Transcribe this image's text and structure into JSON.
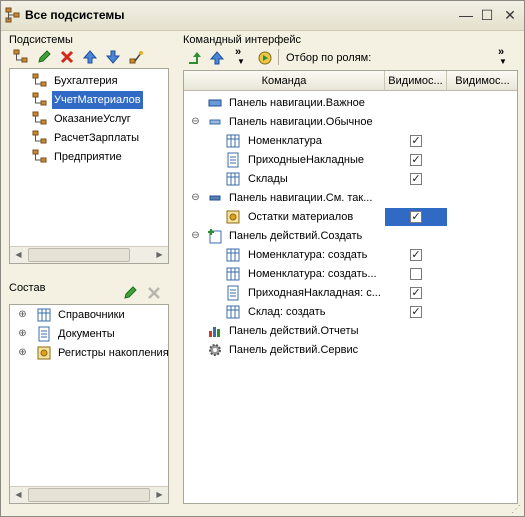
{
  "window": {
    "title": "Все подсистемы",
    "controls": {
      "minimize": "—",
      "maximize": "☐",
      "close": "✕"
    }
  },
  "subsystems": {
    "label": "Подсистемы",
    "items": [
      {
        "label": "Бухгалтерия"
      },
      {
        "label": "УчетМатериалов",
        "selected": true
      },
      {
        "label": "ОказаниеУслуг"
      },
      {
        "label": "РасчетЗарплаты"
      },
      {
        "label": "Предприятие"
      }
    ]
  },
  "composition": {
    "label": "Состав",
    "items": [
      {
        "label": "Справочники"
      },
      {
        "label": "Документы"
      },
      {
        "label": "Регистры накопления"
      }
    ]
  },
  "command_interface": {
    "label": "Командный интерфейс",
    "filter_label": "Отбор по ролям:",
    "columns": [
      "Команда",
      "Видимос...",
      "Видимос..."
    ],
    "rows": [
      {
        "label": "Панель навигации.Важное",
        "level": 0,
        "icon": "nav-panel-icon"
      },
      {
        "label": "Панель навигации.Обычное",
        "level": 0,
        "icon": "nav-panel-icon",
        "expander": "−"
      },
      {
        "label": "Номенклатура",
        "level": 1,
        "icon": "catalog-icon",
        "visible": true
      },
      {
        "label": "ПриходныеНакладные",
        "level": 1,
        "icon": "document-icon",
        "visible": true
      },
      {
        "label": "Склады",
        "level": 1,
        "icon": "catalog-icon",
        "visible": true
      },
      {
        "label": "Панель навигации.См. так...",
        "level": 0,
        "icon": "nav-panel-icon",
        "expander": "−"
      },
      {
        "label": "Остатки материалов",
        "level": 1,
        "icon": "register-icon",
        "visible": true,
        "selected": true
      },
      {
        "label": "Панель действий.Создать",
        "level": 0,
        "icon": "create-icon",
        "expander": "−"
      },
      {
        "label": "Номенклатура: создать",
        "level": 1,
        "icon": "catalog-icon",
        "visible": true
      },
      {
        "label": "Номенклатура: создать...",
        "level": 1,
        "icon": "catalog-icon",
        "visible": false
      },
      {
        "label": "ПриходнаяНакладная: с...",
        "level": 1,
        "icon": "document-icon",
        "visible": true
      },
      {
        "label": "Склад: создать",
        "level": 1,
        "icon": "catalog-icon",
        "visible": true
      },
      {
        "label": "Панель действий.Отчеты",
        "level": 0,
        "icon": "reports-icon"
      },
      {
        "label": "Панель действий.Сервис",
        "level": 0,
        "icon": "service-icon"
      }
    ]
  },
  "colors": {
    "selection": "#316ac5",
    "window_bg": "#f4f1e2"
  }
}
